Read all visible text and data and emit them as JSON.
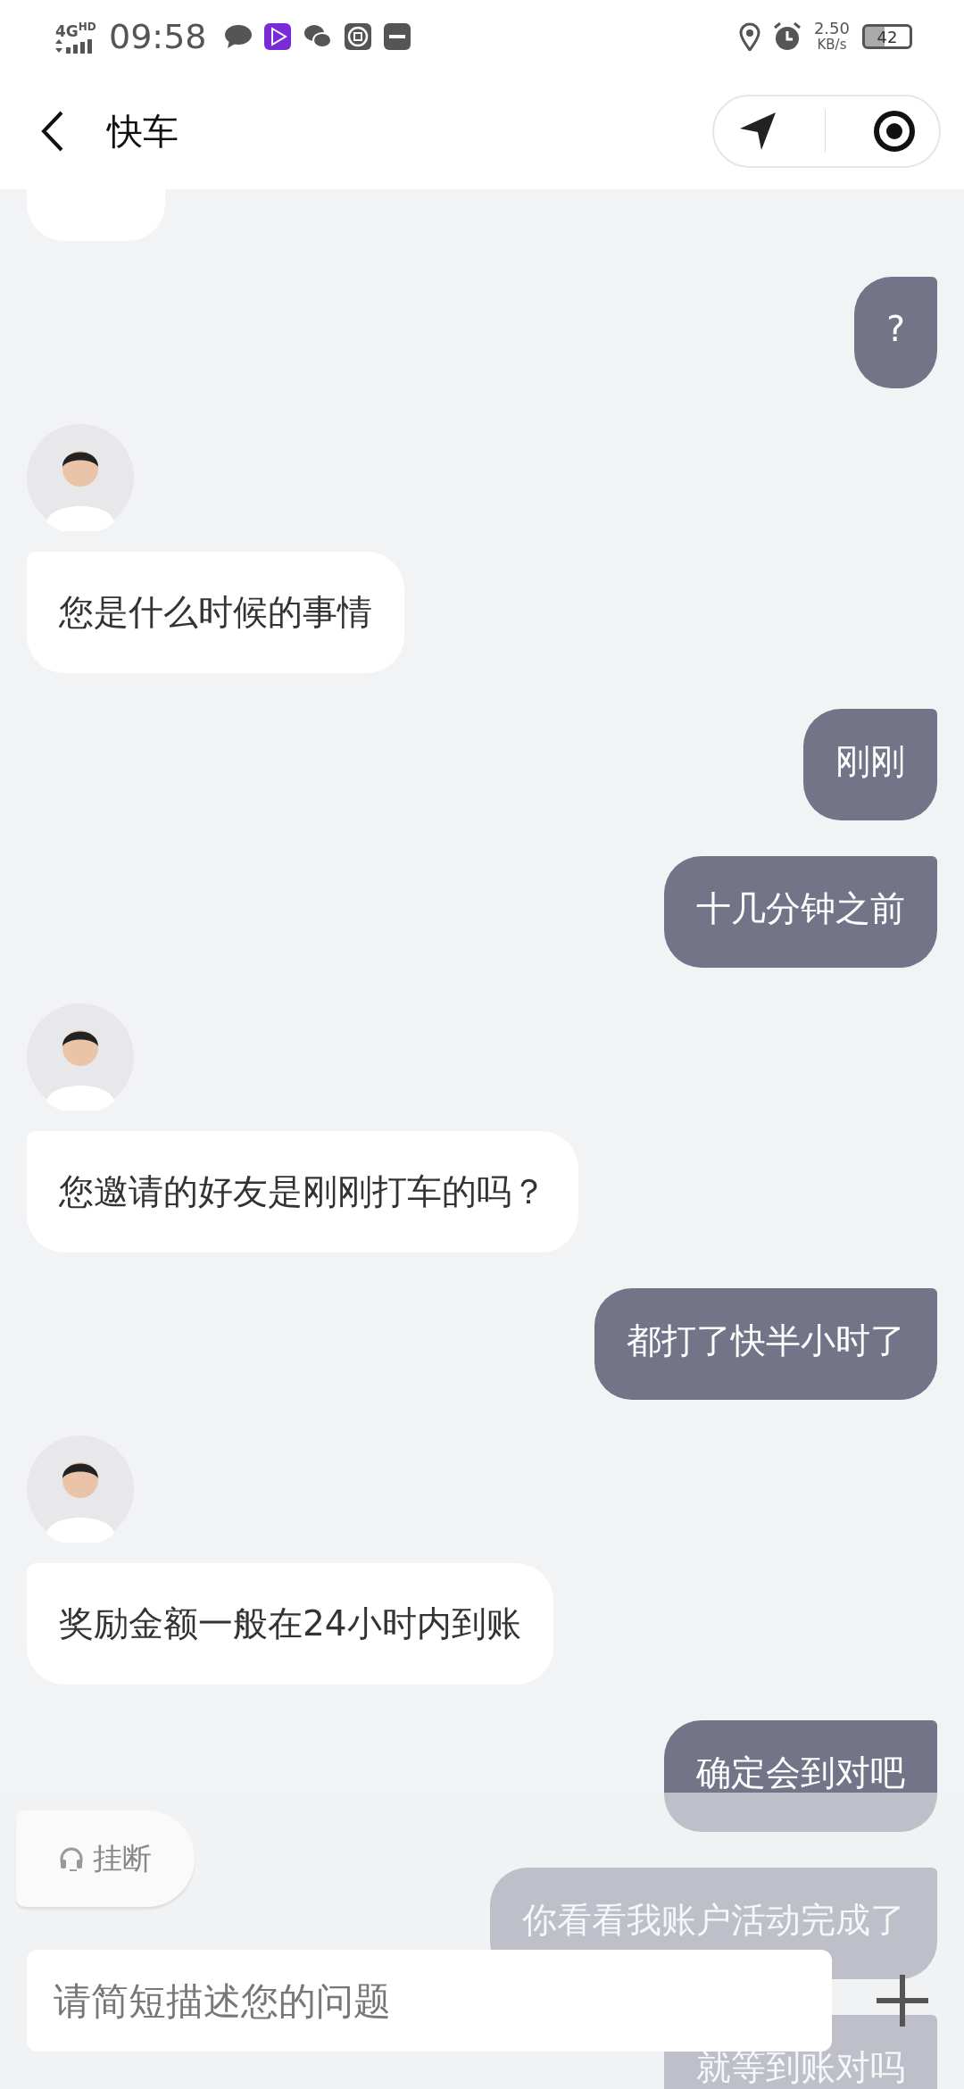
{
  "status_bar": {
    "network": "4G",
    "network_badge": "HD",
    "time": "09:58",
    "speed": "2.50",
    "speed_unit": "KB/s",
    "battery": "42"
  },
  "header": {
    "title": "快车"
  },
  "messages": [
    {
      "kind": "partial"
    },
    {
      "kind": "text",
      "outgoing": true,
      "text": "?"
    },
    {
      "kind": "avatar"
    },
    {
      "kind": "text",
      "outgoing": false,
      "text": "您是什么时候的事情"
    },
    {
      "kind": "text",
      "outgoing": true,
      "text": "刚刚"
    },
    {
      "kind": "text",
      "outgoing": true,
      "text": "十几分钟之前"
    },
    {
      "kind": "avatar"
    },
    {
      "kind": "text",
      "outgoing": false,
      "text": "您邀请的好友是刚刚打车的吗？"
    },
    {
      "kind": "text",
      "outgoing": true,
      "text": "都打了快半小时了"
    },
    {
      "kind": "avatar"
    },
    {
      "kind": "text",
      "outgoing": false,
      "text": "奖励金额一般在24小时内到账"
    },
    {
      "kind": "text",
      "outgoing": true,
      "text": "确定会到对吧"
    },
    {
      "kind": "text",
      "outgoing": true,
      "text": "你看看我账户活动完成了"
    },
    {
      "kind": "text",
      "outgoing": true,
      "text": "就等到账对吗"
    }
  ],
  "hangup_button": {
    "label": "挂断"
  },
  "input": {
    "placeholder": "请简短描述您的问题"
  }
}
